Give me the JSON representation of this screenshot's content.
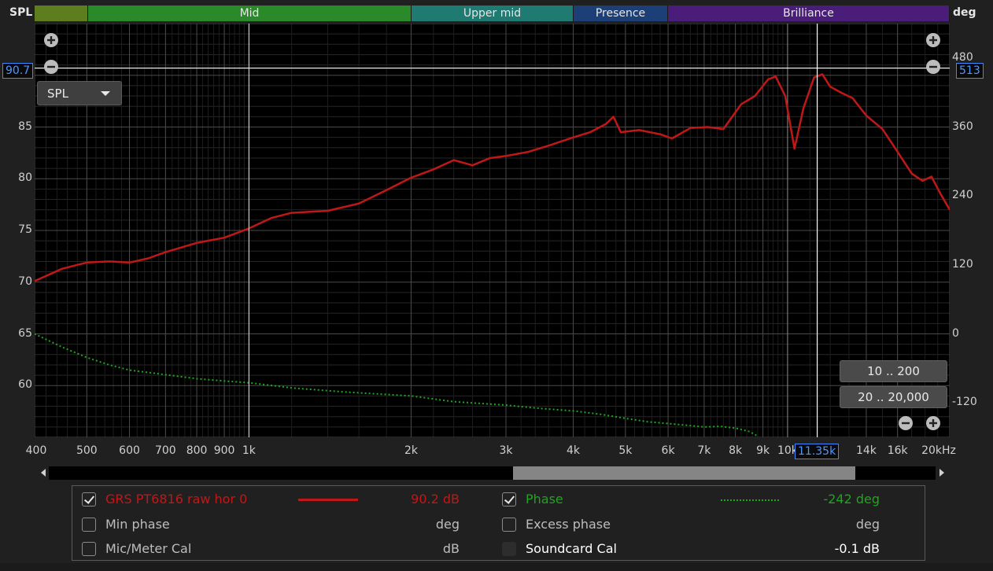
{
  "header": {
    "spl_label": "SPL",
    "deg_label": "deg"
  },
  "bands": [
    {
      "name": "",
      "color": "#5e7d1e"
    },
    {
      "name": "Mid",
      "color": "#2a8a2a"
    },
    {
      "name": "Upper mid",
      "color": "#1f7a72"
    },
    {
      "name": "Presence",
      "color": "#1c3f78"
    },
    {
      "name": "Brilliance",
      "color": "#4a1d7a"
    }
  ],
  "cursor": {
    "spl_value": "90.7",
    "deg_value": "513",
    "freq_value": "11.35k"
  },
  "dropdown": {
    "value": "SPL"
  },
  "range_buttons": {
    "low": "10 .. 200",
    "full": "20 .. 20,000"
  },
  "chart_data": {
    "type": "line",
    "xlabel": "kHz",
    "x_scale": "log",
    "xlim": [
      400,
      20000
    ],
    "ylim_left": [
      55,
      95
    ],
    "ylim_right": [
      -180,
      540
    ],
    "y_left_ticks": [
      60,
      65,
      70,
      75,
      80,
      85,
      90
    ],
    "y_right_ticks": [
      -120,
      0,
      120,
      240,
      360,
      480
    ],
    "x_ticks": [
      {
        "v": 400,
        "label": "400"
      },
      {
        "v": 500,
        "label": "500"
      },
      {
        "v": 600,
        "label": "600"
      },
      {
        "v": 700,
        "label": "700"
      },
      {
        "v": 800,
        "label": "800"
      },
      {
        "v": 900,
        "label": "900"
      },
      {
        "v": 1000,
        "label": "1k"
      },
      {
        "v": 2000,
        "label": "2k"
      },
      {
        "v": 3000,
        "label": "3k"
      },
      {
        "v": 4000,
        "label": "4k"
      },
      {
        "v": 5000,
        "label": "5k"
      },
      {
        "v": 6000,
        "label": "6k"
      },
      {
        "v": 7000,
        "label": "7k"
      },
      {
        "v": 8000,
        "label": "8k"
      },
      {
        "v": 9000,
        "label": "9k"
      },
      {
        "v": 10000,
        "label": "10k"
      },
      {
        "v": 14000,
        "label": "14k"
      },
      {
        "v": 16000,
        "label": "16k"
      },
      {
        "v": 20000,
        "label": "20kHz"
      }
    ],
    "grid": true,
    "cursor_x": 11350,
    "cursor_y": 90.7,
    "series": [
      {
        "name": "GRS PT6816 raw hor 0",
        "axis": "left",
        "color": "#c01818",
        "style": "solid",
        "points": [
          [
            400,
            70.1
          ],
          [
            450,
            71.3
          ],
          [
            500,
            71.9
          ],
          [
            550,
            72.0
          ],
          [
            600,
            71.9
          ],
          [
            650,
            72.3
          ],
          [
            700,
            72.9
          ],
          [
            800,
            73.8
          ],
          [
            900,
            74.3
          ],
          [
            1000,
            75.2
          ],
          [
            1100,
            76.2
          ],
          [
            1200,
            76.7
          ],
          [
            1400,
            76.9
          ],
          [
            1600,
            77.6
          ],
          [
            1800,
            78.9
          ],
          [
            2000,
            80.1
          ],
          [
            2200,
            80.9
          ],
          [
            2400,
            81.8
          ],
          [
            2600,
            81.3
          ],
          [
            2800,
            82.0
          ],
          [
            3000,
            82.2
          ],
          [
            3300,
            82.6
          ],
          [
            3600,
            83.2
          ],
          [
            4000,
            84.0
          ],
          [
            4300,
            84.5
          ],
          [
            4600,
            85.3
          ],
          [
            4750,
            86.0
          ],
          [
            4900,
            84.5
          ],
          [
            5300,
            84.7
          ],
          [
            5800,
            84.3
          ],
          [
            6100,
            83.9
          ],
          [
            6600,
            84.9
          ],
          [
            7100,
            85.0
          ],
          [
            7600,
            84.8
          ],
          [
            8200,
            87.2
          ],
          [
            8700,
            88.0
          ],
          [
            9200,
            89.6
          ],
          [
            9500,
            89.9
          ],
          [
            9900,
            88.0
          ],
          [
            10300,
            82.9
          ],
          [
            10700,
            86.8
          ],
          [
            11200,
            89.8
          ],
          [
            11600,
            90.1
          ],
          [
            12000,
            88.9
          ],
          [
            12600,
            88.3
          ],
          [
            13200,
            87.8
          ],
          [
            14000,
            86.1
          ],
          [
            15000,
            84.8
          ],
          [
            16000,
            82.6
          ],
          [
            17000,
            80.5
          ],
          [
            17800,
            79.8
          ],
          [
            18500,
            80.2
          ],
          [
            19200,
            78.6
          ],
          [
            20000,
            77.0
          ]
        ]
      },
      {
        "name": "Phase",
        "axis": "right",
        "color": "#1fa51f",
        "style": "dotted",
        "points": [
          [
            400,
            0
          ],
          [
            450,
            -23
          ],
          [
            500,
            -41
          ],
          [
            550,
            -54
          ],
          [
            600,
            -63
          ],
          [
            700,
            -71
          ],
          [
            800,
            -78
          ],
          [
            900,
            -82
          ],
          [
            1000,
            -85
          ],
          [
            1200,
            -94
          ],
          [
            1500,
            -101
          ],
          [
            2000,
            -108
          ],
          [
            2400,
            -118
          ],
          [
            3000,
            -124
          ],
          [
            3500,
            -130
          ],
          [
            4000,
            -134
          ],
          [
            4500,
            -140
          ],
          [
            5000,
            -147
          ],
          [
            5500,
            -153
          ],
          [
            6000,
            -156
          ],
          [
            6500,
            -159
          ],
          [
            7000,
            -162
          ],
          [
            7500,
            -161
          ],
          [
            8000,
            -164
          ],
          [
            8500,
            -170
          ],
          [
            8800,
            -178
          ]
        ]
      }
    ]
  },
  "legend": {
    "row1": {
      "name": "GRS PT6816 raw hor 0",
      "value": "90.2 dB",
      "checked": true,
      "color": "#c01818"
    },
    "row2": {
      "name": "Min phase",
      "value": "deg",
      "checked": false
    },
    "row3": {
      "name": "Mic/Meter Cal",
      "value": "dB",
      "checked": false
    },
    "row4": {
      "name": "Phase",
      "value": "-242 deg",
      "checked": true,
      "color": "#1fa51f"
    },
    "row5": {
      "name": "Excess phase",
      "value": "deg",
      "checked": false
    },
    "row6": {
      "name": "Soundcard Cal",
      "value": "-0.1 dB",
      "checked": false
    }
  }
}
